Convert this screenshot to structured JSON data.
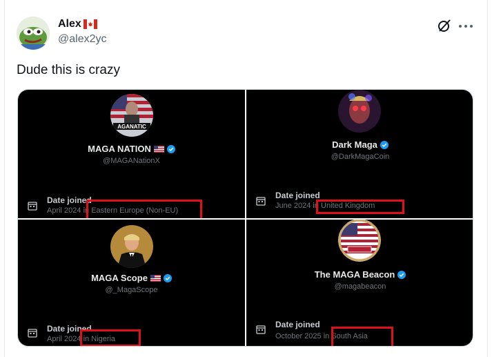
{
  "post": {
    "author_name": "Alex",
    "author_flag": "🇨🇦",
    "handle": "@alex2yc",
    "text": "Dude this is crazy"
  },
  "icons": {
    "grok": "grok-icon",
    "more": "more-icon"
  },
  "accounts": [
    {
      "name": "MAGA NATION",
      "flag": "🇺🇸",
      "handle": "@MAGANationX",
      "date_label": "Date joined",
      "date_value": "April 2024 in Eastern Europe (Non-EU)"
    },
    {
      "name": "Dark Maga",
      "flag": "",
      "handle": "@DarkMagaCoin",
      "date_label": "Date joined",
      "date_value": "June 2024 in United Kingdom"
    },
    {
      "name": "MAGA Scope",
      "flag": "🇺🇸",
      "handle": "@_MagaScope",
      "date_label": "Date joined",
      "date_value": "April 2024 in Nigeria"
    },
    {
      "name": "The MAGA Beacon",
      "flag": "",
      "handle": "@magabeacon",
      "date_label": "Date joined",
      "date_value": "October 2025 in South Asia"
    }
  ],
  "colors": {
    "highlight": "#e0101a",
    "verified": "#1d9bf0",
    "panel_bg": "#000000"
  }
}
